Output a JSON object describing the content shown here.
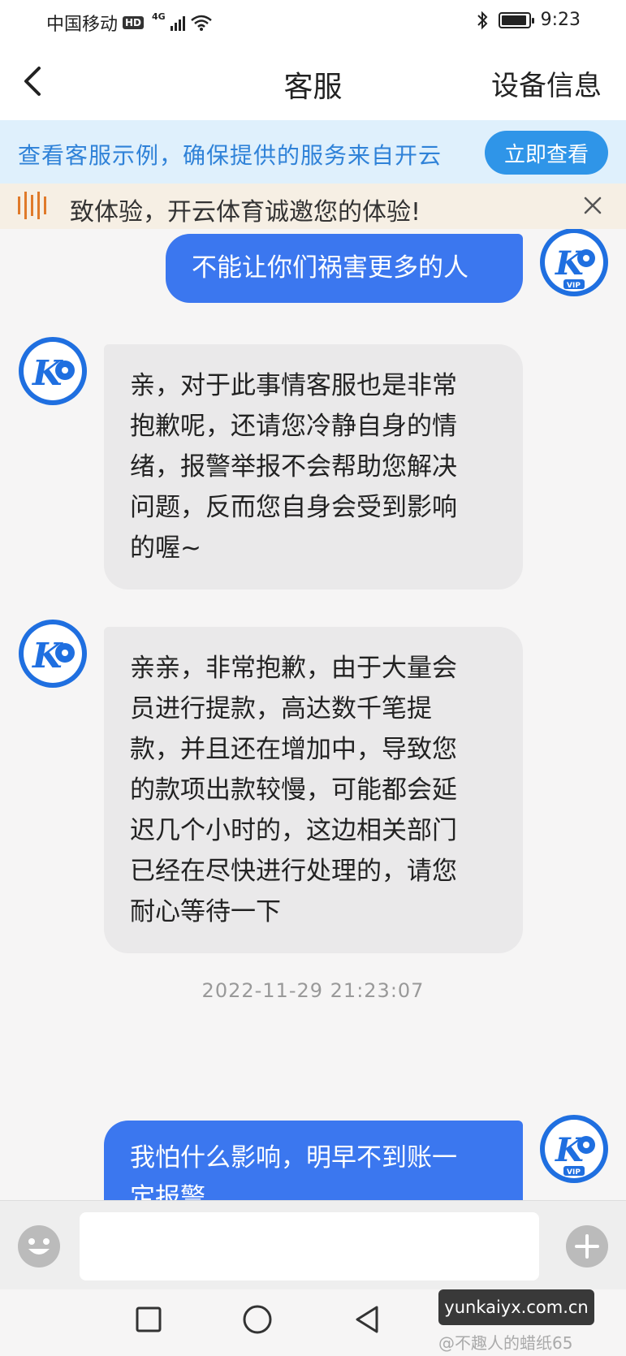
{
  "status_bar": {
    "carrier": "中国移动",
    "hd": "HD",
    "network": "4G",
    "time": "9:23"
  },
  "nav": {
    "title": "客服",
    "action": "设备信息",
    "back_icon": "chevron-left-icon"
  },
  "banner": {
    "text": "查看客服示例，确保提供的服务来自开云",
    "button": "立即查看"
  },
  "notice": {
    "text": "致体验，开云体育诚邀您的体验!",
    "icon": "sound-wave-icon"
  },
  "messages": [
    {
      "from": "user",
      "lines": [
        "不能让你们祸害更多的人"
      ],
      "avatar_badge": "VIP"
    },
    {
      "from": "agent",
      "lines": [
        "亲，对于此事情客服也是非常",
        "抱歉呢，还请您冷静自身的情",
        "绪，报警举报不会帮助您解决",
        "问题，反而您自身会受到影响",
        "的喔~"
      ]
    },
    {
      "from": "agent",
      "lines": [
        "亲亲，非常抱歉，由于大量会",
        "员进行提款，高达数千笔提",
        "款，并且还在增加中，导致您",
        "的款项出款较慢，可能都会延",
        "迟几个小时的，这边相关部门",
        "已经在尽快进行处理的，请您",
        "耐心等待一下"
      ]
    },
    {
      "from": "user",
      "lines": [
        "我怕什么影响，明早不到账一",
        "定报警"
      ],
      "avatar_badge": "VIP"
    }
  ],
  "timestamp": "2022-11-29 21:23:07",
  "input": {
    "placeholder": "",
    "value": ""
  },
  "watermark": {
    "site": "yunkaiyx.com.cn",
    "author": "@不趣人的蜡纸65"
  },
  "colors": {
    "user_bubble": "#3b77ef",
    "agent_bubble": "#eae9ea",
    "banner_bg": "#dff0fc",
    "banner_text": "#2f82d8",
    "banner_button": "#2f95e8"
  }
}
